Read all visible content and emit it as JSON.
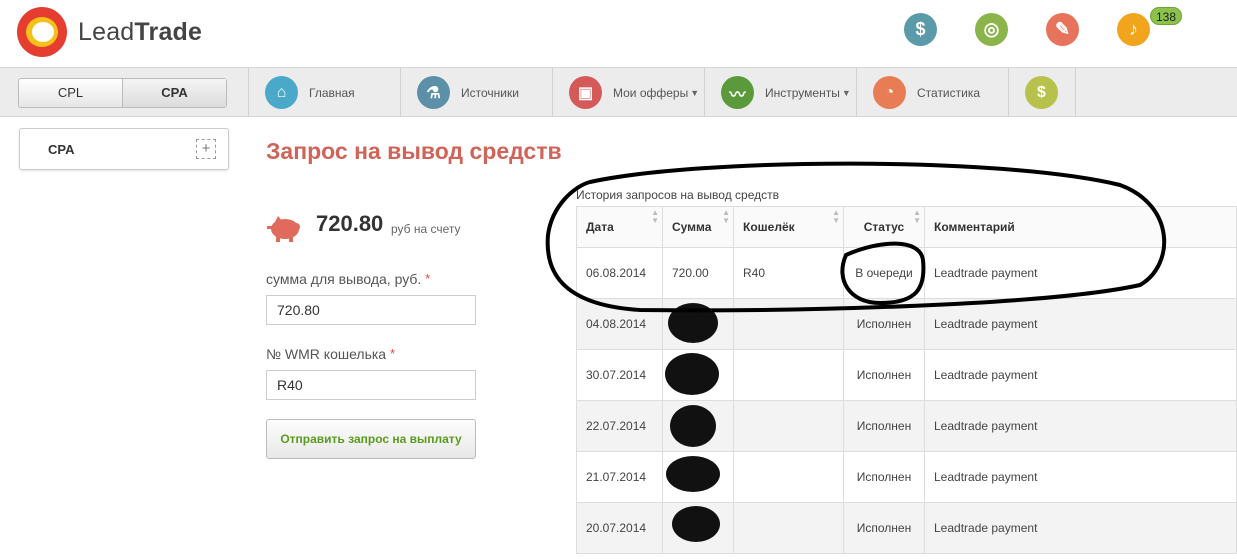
{
  "brand": {
    "part1": "Lead",
    "part2": "Trade"
  },
  "header": {
    "icons": [
      {
        "name": "dollar-icon",
        "color": "#5b9aa9",
        "glyph": "$"
      },
      {
        "name": "lifebuoy-icon",
        "color": "#8bb44b",
        "glyph": "◎"
      },
      {
        "name": "ticket-icon",
        "color": "#e8735c",
        "glyph": "✎"
      },
      {
        "name": "bell-icon",
        "color": "#f0a51c",
        "glyph": "♪"
      }
    ],
    "notifications_count": "138"
  },
  "mode_switch": {
    "cpl": "CPL",
    "cpa": "CPA",
    "active": "CPA"
  },
  "nav": {
    "home": "Главная",
    "sources": "Источники",
    "offers": "Мои офферы",
    "tools": "Инструменты",
    "stats": "Статистика"
  },
  "nav_colors": {
    "home": "#4aa8c9",
    "sources": "#5c8fa8",
    "offers": "#d45a5a",
    "tools": "#5a9a3a",
    "stats": "#e87d55",
    "finance": "#b6c24b"
  },
  "sidebar": {
    "label": "CPA"
  },
  "page": {
    "title": "Запрос на вывод средств"
  },
  "balance": {
    "amount": "720.80",
    "suffix": "руб на счету"
  },
  "form": {
    "amount_label": "сумма для вывода, руб.",
    "amount_value": "720.80",
    "wallet_label": "№ WMR кошелька",
    "wallet_value": "R40",
    "required_mark": "*",
    "submit": "Отправить запрос на выплату"
  },
  "history": {
    "caption": "История запросов на вывод средств",
    "columns": [
      "Дата",
      "Сумма",
      "Кошелёк",
      "Статус",
      "Комментарий"
    ],
    "rows": [
      {
        "date": "06.08.2014",
        "amount": "720.00",
        "wallet": "R40",
        "status": "В очереди",
        "comment": "Leadtrade payment"
      },
      {
        "date": "04.08.2014",
        "amount": "",
        "wallet": "",
        "status": "Исполнен",
        "comment": "Leadtrade payment"
      },
      {
        "date": "30.07.2014",
        "amount": "",
        "wallet": "",
        "status": "Исполнен",
        "comment": "Leadtrade payment"
      },
      {
        "date": "22.07.2014",
        "amount": "",
        "wallet": "",
        "status": "Исполнен",
        "comment": "Leadtrade payment"
      },
      {
        "date": "21.07.2014",
        "amount": "",
        "wallet": "",
        "status": "Исполнен",
        "comment": "Leadtrade payment"
      },
      {
        "date": "20.07.2014",
        "amount": "",
        "wallet": "",
        "status": "Исполнен",
        "comment": "Leadtrade payment"
      }
    ]
  }
}
